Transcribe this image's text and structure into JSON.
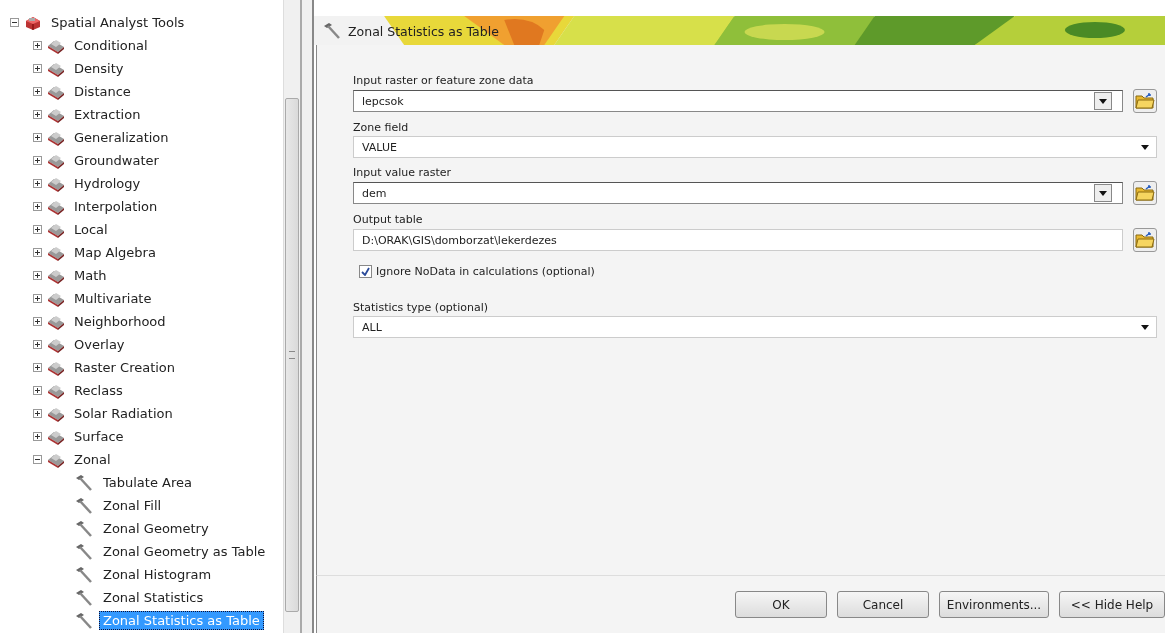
{
  "toolbox": {
    "label": "Spatial Analyst Tools",
    "expanded": true,
    "selected": false,
    "children": [
      {
        "kind": "toolset",
        "label": "Conditional",
        "expanded": false,
        "selected": false
      },
      {
        "kind": "toolset",
        "label": "Density",
        "expanded": false,
        "selected": false
      },
      {
        "kind": "toolset",
        "label": "Distance",
        "expanded": false,
        "selected": false
      },
      {
        "kind": "toolset",
        "label": "Extraction",
        "expanded": false,
        "selected": false
      },
      {
        "kind": "toolset",
        "label": "Generalization",
        "expanded": false,
        "selected": false
      },
      {
        "kind": "toolset",
        "label": "Groundwater",
        "expanded": false,
        "selected": false
      },
      {
        "kind": "toolset",
        "label": "Hydrology",
        "expanded": false,
        "selected": false
      },
      {
        "kind": "toolset",
        "label": "Interpolation",
        "expanded": false,
        "selected": false
      },
      {
        "kind": "toolset",
        "label": "Local",
        "expanded": false,
        "selected": false
      },
      {
        "kind": "toolset",
        "label": "Map Algebra",
        "expanded": false,
        "selected": false
      },
      {
        "kind": "toolset",
        "label": "Math",
        "expanded": false,
        "selected": false
      },
      {
        "kind": "toolset",
        "label": "Multivariate",
        "expanded": false,
        "selected": false
      },
      {
        "kind": "toolset",
        "label": "Neighborhood",
        "expanded": false,
        "selected": false
      },
      {
        "kind": "toolset",
        "label": "Overlay",
        "expanded": false,
        "selected": false
      },
      {
        "kind": "toolset",
        "label": "Raster Creation",
        "expanded": false,
        "selected": false
      },
      {
        "kind": "toolset",
        "label": "Reclass",
        "expanded": false,
        "selected": false
      },
      {
        "kind": "toolset",
        "label": "Solar Radiation",
        "expanded": false,
        "selected": false
      },
      {
        "kind": "toolset",
        "label": "Surface",
        "expanded": false,
        "selected": false
      },
      {
        "kind": "toolset",
        "label": "Zonal",
        "expanded": true,
        "selected": false,
        "children": [
          {
            "kind": "tool",
            "label": "Tabulate Area",
            "selected": false
          },
          {
            "kind": "tool",
            "label": "Zonal Fill",
            "selected": false
          },
          {
            "kind": "tool",
            "label": "Zonal Geometry",
            "selected": false
          },
          {
            "kind": "tool",
            "label": "Zonal Geometry as Table",
            "selected": false
          },
          {
            "kind": "tool",
            "label": "Zonal Histogram",
            "selected": false
          },
          {
            "kind": "tool",
            "label": "Zonal Statistics",
            "selected": false
          },
          {
            "kind": "tool",
            "label": "Zonal Statistics as Table",
            "selected": true
          }
        ]
      }
    ]
  },
  "dialog": {
    "title": "Zonal Statistics as Table",
    "params": [
      {
        "kind": "combo",
        "label": "Input raster or feature zone data",
        "value": "lepcsok",
        "browse": true
      },
      {
        "kind": "dropdown",
        "label": "Zone field",
        "value": "VALUE",
        "browse": false
      },
      {
        "kind": "combo",
        "label": "Input value raster",
        "value": "dem",
        "browse": true
      },
      {
        "kind": "text",
        "label": "Output table",
        "value": "D:\\ORAK\\GIS\\domborzat\\lekerdezes",
        "browse": true
      },
      {
        "kind": "checkbox",
        "label": "Ignore NoData in calculations (optional)",
        "checked": true
      },
      {
        "kind": "dropdown",
        "label": "Statistics type (optional)",
        "value": "ALL",
        "browse": false
      }
    ],
    "buttons": [
      "OK",
      "Cancel",
      "Environments...",
      "<< Hide Help"
    ]
  }
}
